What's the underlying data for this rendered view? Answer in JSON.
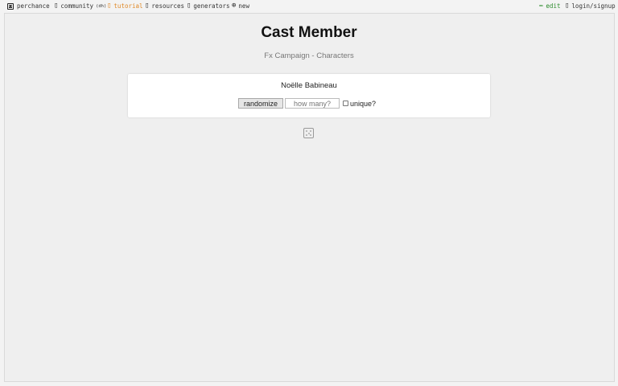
{
  "nav": {
    "perchance": "perchance",
    "community": "community",
    "community_badge": "(dh)",
    "tutorial": "tutorial",
    "resources": "resources",
    "generators": "generators",
    "new": "new",
    "edit": "edit",
    "login": "login/signup"
  },
  "icons": {
    "logo": "dice-icon",
    "community": "chat-icon",
    "tutorial": "book-icon",
    "resources": "book-icon",
    "generators": "list-icon",
    "new": "plus-circle-icon",
    "edit": "pencil-icon",
    "login": "user-icon"
  },
  "page": {
    "title": "Cast Member",
    "subtitle": "Fx Campaign - Characters",
    "output": "Noëlle Babineau"
  },
  "controls": {
    "randomize_label": "randomize",
    "count_placeholder": "how many?",
    "unique_label": "unique?",
    "unique_checked": false
  },
  "colors": {
    "tutorial": "#e08a2a",
    "edit": "#2a8a2a",
    "background": "#efefef"
  }
}
